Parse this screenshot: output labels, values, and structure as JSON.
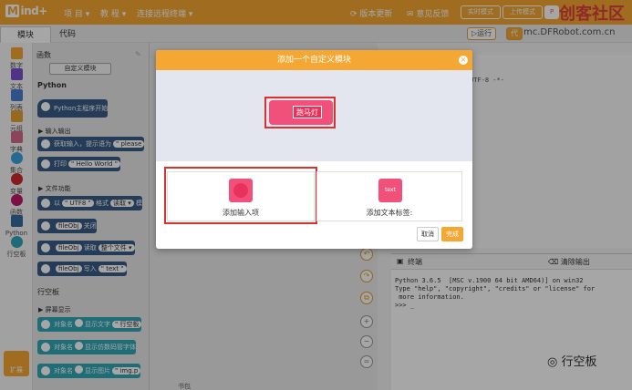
{
  "app": {
    "logo_mark": "M",
    "logo_text": "ind+"
  },
  "menu": {
    "project": "项 目 ▾",
    "tutorial": "教 程 ▾",
    "remote": "连接远程终端 ▾",
    "update": "版本更新",
    "feedback": "意见反馈",
    "realtime": "实时模式",
    "upload": "上传模式",
    "python": "P"
  },
  "watermark": {
    "title": "创客社区",
    "url": "mc.DFRobot.com.cn",
    "brand": "行空板"
  },
  "tabs": {
    "module": "模块",
    "code": "代码",
    "run": "▷运行",
    "ai": "代"
  },
  "categories": [
    {
      "label": "数字",
      "color": "#f4a732"
    },
    {
      "label": "文本",
      "color": "#7a4fd0"
    },
    {
      "label": "列表",
      "color": "#4b7fd4"
    },
    {
      "label": "元组",
      "color": "#e8a030"
    },
    {
      "label": "字典",
      "color": "#d46a8a"
    },
    {
      "label": "集合",
      "color": "#3aa3e0"
    },
    {
      "label": "变量",
      "color": "#cc2a2a"
    },
    {
      "label": "函数",
      "color": "#c2186b"
    },
    {
      "label": "Python",
      "color": "#356aa0"
    },
    {
      "label": "行空板",
      "color": "#2da7b7"
    },
    {
      "label": "扩展",
      "color": "#f4a732"
    }
  ],
  "palette": {
    "title": "函数",
    "custom_btn": "自定义模块",
    "python_heading": "Python",
    "main_block": "Python主程序开始",
    "io_heading": "输入输出",
    "input_block": "获取输入，提示语为",
    "input_arg": "\" please",
    "print_block": "打印",
    "print_arg": "\" Hello World \"",
    "file_heading": "文件功能",
    "open_block": "以",
    "open_arg1": "\" UTF8 \"",
    "open_word": "格式",
    "open_arg2": "读取 ▾",
    "open_end": "模",
    "close_var": "fileObj",
    "close_word": "关闭",
    "read_var": "fileObj",
    "read_word": "读取",
    "read_arg": "整个文件 ▾",
    "write_var": "fileObj",
    "write_word": "写入",
    "write_arg": "\" text \"",
    "board_heading": "行空板",
    "screen_heading": "屏幕显示",
    "t1": "对象名",
    "t1b": "显示文字",
    "t1c": "\" 行空板",
    "t2": "对象名",
    "t2b": "显示仿数码管字体",
    "t3": "对象名",
    "t3b": "显示图片",
    "t3c": "\" img.p"
  },
  "code": {
    "line1": "UTF-8 -*-"
  },
  "terminal": {
    "title": "终端",
    "clear": "清除输出",
    "output": "Python 3.6.5  [MSC v.1900 64 bit AMD64)] on win32\nType \"help\", \"copyright\", \"credits\" or \"license\" for\n more information.\n>>> _"
  },
  "modal": {
    "title": "添加一个自定义模块",
    "close": "×",
    "preview_label": "跑马灯",
    "opt_input": "添加输入项",
    "opt_text": "添加文本标签:",
    "opt_text_icon": "text",
    "cancel": "取消",
    "done": "完成"
  },
  "bottom": {
    "tab": "书包"
  }
}
